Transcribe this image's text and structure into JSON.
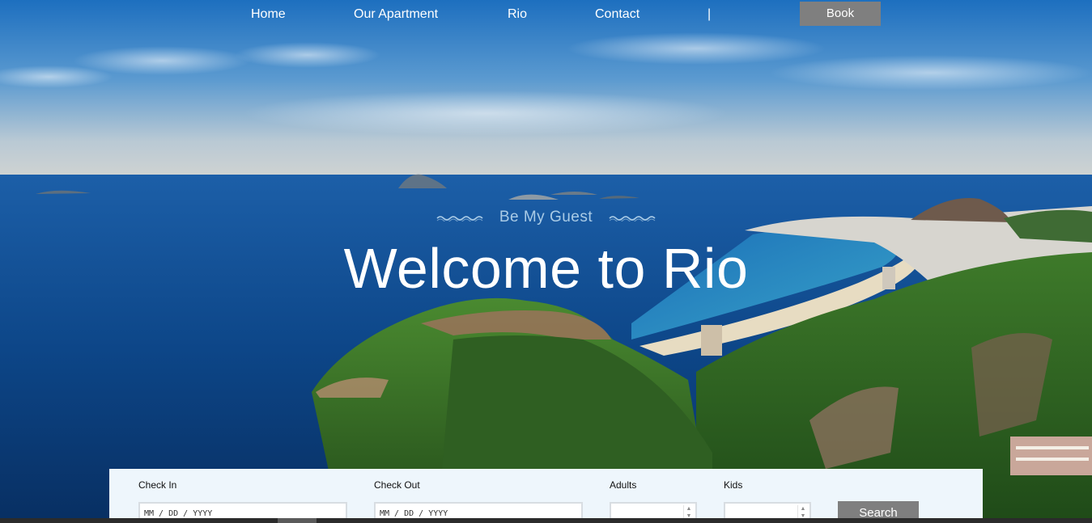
{
  "nav": {
    "items": [
      {
        "label": "Home"
      },
      {
        "label": "Our Apartment"
      },
      {
        "label": "Rio"
      },
      {
        "label": "Contact"
      }
    ],
    "separator": "|",
    "book_label": "Book"
  },
  "hero": {
    "tagline": "Be My Guest",
    "headline": "Welcome to Rio",
    "background": "rio-coastline-photo"
  },
  "booking": {
    "check_in_label": "Check In",
    "check_in_placeholder": "MM / DD / YYYY",
    "check_out_label": "Check Out",
    "check_out_placeholder": "MM / DD / YYYY",
    "adults_label": "Adults",
    "kids_label": "Kids",
    "search_label": "Search"
  },
  "colors": {
    "button_gray": "#7f7f7f",
    "panel_bg": "#eef6fc",
    "tagline_blue": "#a9cbe6"
  }
}
